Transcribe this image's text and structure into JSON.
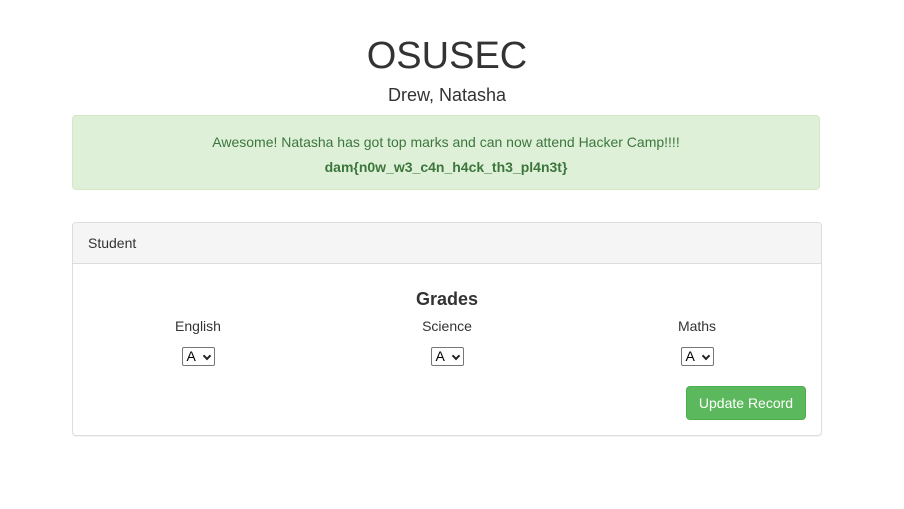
{
  "header": {
    "title": "OSUSEC",
    "student_name": "Drew, Natasha"
  },
  "alert": {
    "message": "Awesome! Natasha has got top marks and can now attend Hacker Camp!!!!",
    "flag": "dam{n0w_w3_c4n_h4ck_th3_pl4n3t}",
    "colors": {
      "background": "#dff0d8",
      "border": "#d6e9c6",
      "text": "#3c763d"
    }
  },
  "panel": {
    "heading": "Student",
    "grades_title": "Grades",
    "subjects": [
      {
        "label": "English",
        "selected": "A"
      },
      {
        "label": "Science",
        "selected": "A"
      },
      {
        "label": "Maths",
        "selected": "A"
      }
    ],
    "update_label": "Update Record",
    "button_color": "#5cb85c"
  }
}
